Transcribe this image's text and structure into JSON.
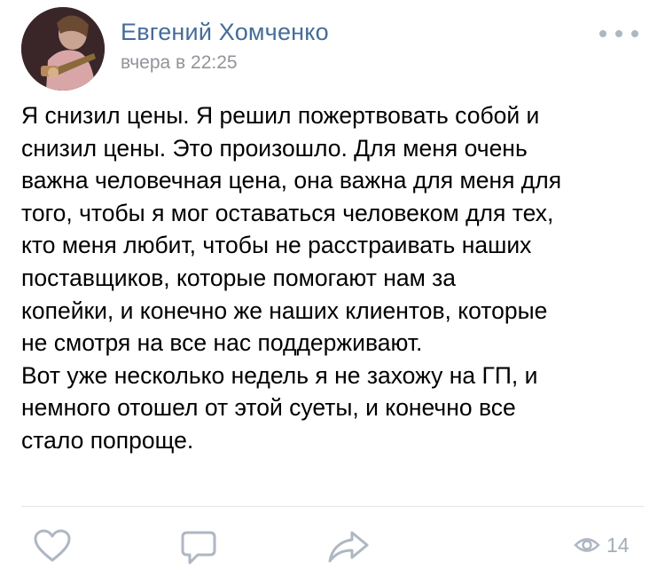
{
  "post": {
    "author": "Евгений Хомченко",
    "time": "вчера в 22:25",
    "text_lines": [
      "Я снизил цены. Я решил пожертвовать собой и",
      "снизил цены. Это произошло. Для меня очень",
      "важна человечная цена, она важна для меня для",
      "того, чтобы я мог оставаться человеком для тех,",
      "кто меня любит, чтобы не расстраивать наших",
      "поставщиков, которые помогают нам за",
      "копейки, и конечно же наших клиентов, которые",
      "не смотря на все нас поддерживают.",
      "Вот уже несколько недель я не захожу на ГП, и",
      "немного отошел от этой суеты, и конечно все",
      "стало попроще."
    ],
    "views": "14"
  },
  "icons": {
    "more": "more-dots-icon",
    "like": "heart-icon",
    "comment": "comment-icon",
    "share": "share-arrow-icon",
    "views": "eye-icon"
  },
  "colors": {
    "author": "#456c99",
    "meta": "#909499",
    "icon": "#aeb7c2",
    "views": "#a3adb8",
    "divider": "#e3e4e8"
  }
}
